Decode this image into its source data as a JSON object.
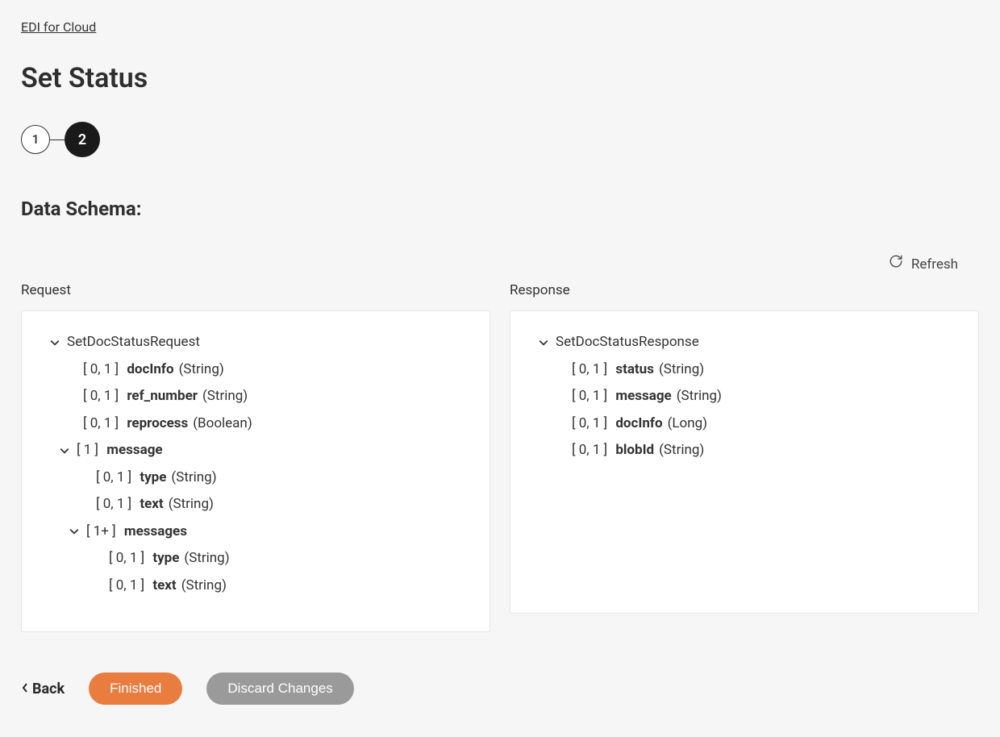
{
  "breadcrumb": "EDI for Cloud",
  "title": "Set Status",
  "stepper": {
    "step1": "1",
    "step2": "2"
  },
  "section": "Data Schema:",
  "refresh": "Refresh",
  "request_label": "Request",
  "response_label": "Response",
  "request": {
    "root": "SetDocStatusRequest",
    "f0": {
      "card": "[ 0, 1 ] ",
      "name": "docInfo",
      "type": " (String)"
    },
    "f1": {
      "card": "[ 0, 1 ] ",
      "name": "ref_number",
      "type": " (String)"
    },
    "f2": {
      "card": "[ 0, 1 ] ",
      "name": "reprocess",
      "type": " (Boolean)"
    },
    "msg": {
      "card": "[ 1 ] ",
      "name": "message"
    },
    "msg_f0": {
      "card": "[ 0, 1 ] ",
      "name": "type",
      "type": " (String)"
    },
    "msg_f1": {
      "card": "[ 0, 1 ] ",
      "name": "text",
      "type": " (String)"
    },
    "msgs": {
      "card": "[ 1+ ] ",
      "name": "messages"
    },
    "msgs_f0": {
      "card": "[ 0, 1 ] ",
      "name": "type",
      "type": " (String)"
    },
    "msgs_f1": {
      "card": "[ 0, 1 ] ",
      "name": "text",
      "type": " (String)"
    }
  },
  "response": {
    "root": "SetDocStatusResponse",
    "f0": {
      "card": "[ 0, 1 ] ",
      "name": "status",
      "type": " (String)"
    },
    "f1": {
      "card": "[ 0, 1 ] ",
      "name": "message",
      "type": " (String)"
    },
    "f2": {
      "card": "[ 0, 1 ] ",
      "name": "docInfo",
      "type": " (Long)"
    },
    "f3": {
      "card": "[ 0, 1 ] ",
      "name": "blobId",
      "type": " (String)"
    }
  },
  "actions": {
    "back": "Back",
    "finished": "Finished",
    "discard": "Discard Changes"
  }
}
